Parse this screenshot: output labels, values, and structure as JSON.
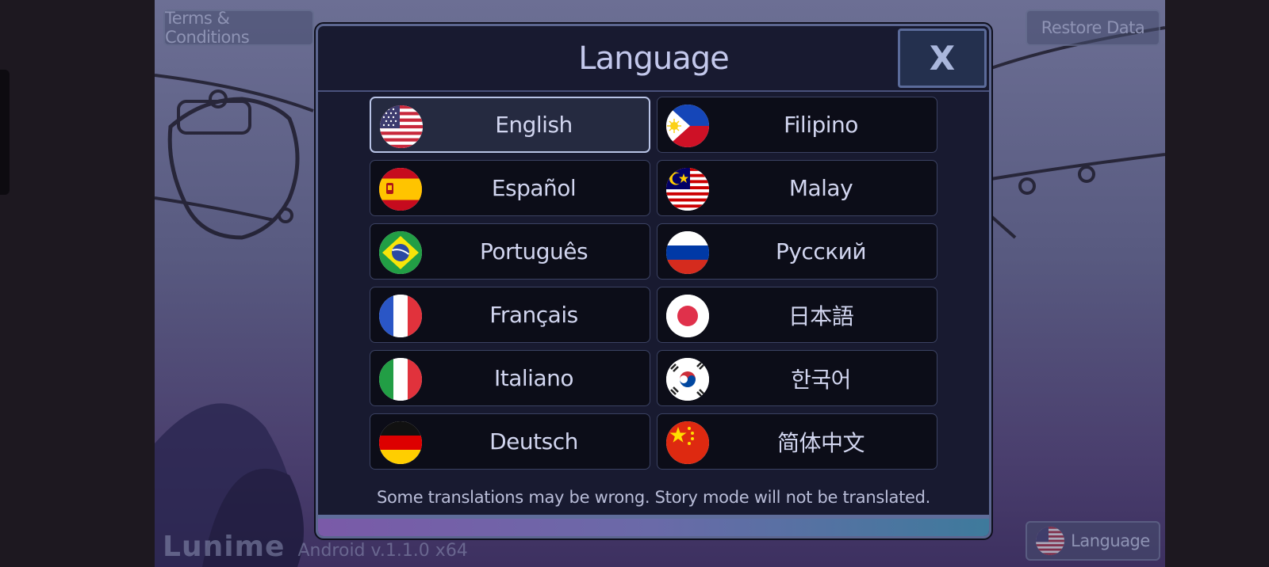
{
  "background": {
    "terms_label": "Terms & Conditions",
    "restore_label": "Restore Data",
    "language_label": "Language",
    "brand": "Lunime",
    "version": "Android v.1.1.0 x64"
  },
  "modal": {
    "title": "Language",
    "close_label": "X",
    "note": "Some translations may be wrong. Story mode will not be translated."
  },
  "languages": [
    {
      "label": "English",
      "flag": "us-flag-icon",
      "selected": true
    },
    {
      "label": "Filipino",
      "flag": "philippines-flag-icon"
    },
    {
      "label": "Español",
      "flag": "spain-flag-icon"
    },
    {
      "label": "Malay",
      "flag": "malaysia-flag-icon"
    },
    {
      "label": "Português",
      "flag": "brazil-flag-icon"
    },
    {
      "label": "Русский",
      "flag": "russia-flag-icon"
    },
    {
      "label": "Français",
      "flag": "france-flag-icon"
    },
    {
      "label": "日本語",
      "flag": "japan-flag-icon"
    },
    {
      "label": "Italiano",
      "flag": "italy-flag-icon"
    },
    {
      "label": "한국어",
      "flag": "korea-flag-icon"
    },
    {
      "label": "Deutsch",
      "flag": "germany-flag-icon"
    },
    {
      "label": "简体中文",
      "flag": "china-flag-icon"
    }
  ],
  "colors": {
    "selected_border": "#b8c3e6",
    "panel_bg": "#181a30",
    "text": "#d2d6f0"
  }
}
